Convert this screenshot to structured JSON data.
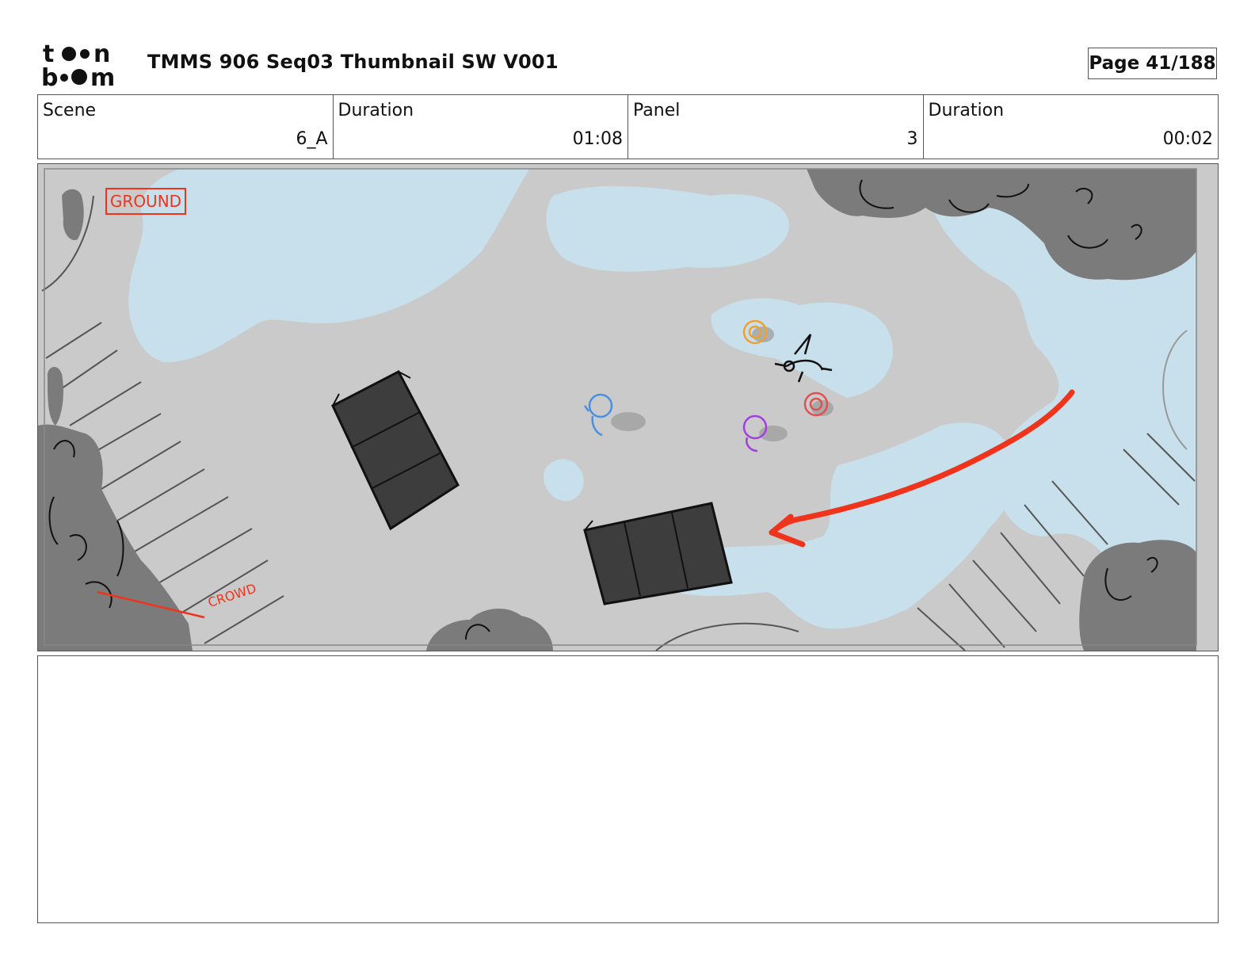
{
  "header": {
    "logo_text": "toon boom",
    "title": "TMMS 906 Seq03 Thumbnail SW V001",
    "page_label": "Page",
    "page_value": "41/188"
  },
  "info": {
    "scene_label": "Scene",
    "scene_value": "6_A",
    "scene_duration_label": "Duration",
    "scene_duration_value": "01:08",
    "panel_label": "Panel",
    "panel_value": "3",
    "panel_duration_label": "Duration",
    "panel_duration_value": "00:02"
  },
  "panel": {
    "ground_label": "GROUND",
    "crowd_label": "CROWD",
    "colors": {
      "ground": "#cacaca",
      "puddle": "#c8e0ec",
      "shrub": "#7b7b7b",
      "vehicle": "#3d3d3d",
      "arrow": "#f0341c",
      "char_blue": "#4a90e2",
      "char_orange": "#f0a030",
      "char_purple": "#a040e0",
      "char_red": "#e05050"
    }
  },
  "notes": {
    "text": ""
  }
}
